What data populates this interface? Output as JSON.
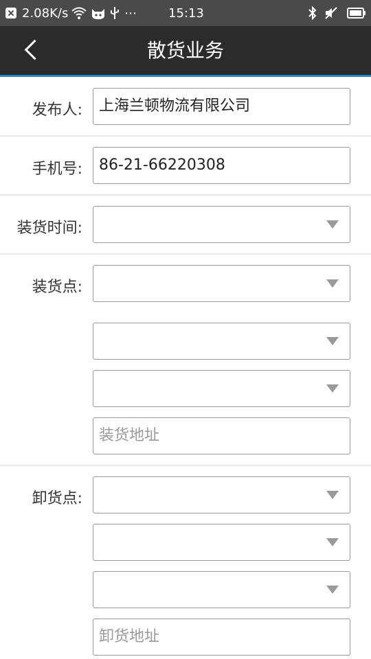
{
  "status_bar": {
    "net_speed": "2.08K/s",
    "misc_icons": "⋯",
    "time": "15:13"
  },
  "header": {
    "title": "散货业务"
  },
  "form": {
    "publisher_label": "发布人:",
    "publisher_value": "上海兰顿物流有限公司",
    "phone_label": "手机号:",
    "phone_value": "86-21-66220308",
    "load_time_label": "装货时间:",
    "load_point_label": "装货点:",
    "load_address_placeholder": "装货地址",
    "unload_point_label": "卸货点:",
    "unload_address_placeholder": "卸货地址"
  },
  "colors": {
    "status_bar_bg": "#4a4a4a",
    "header_bg": "#2b2b2b",
    "header_accent": "#1e88c8"
  },
  "icons": [
    "close-notification-icon",
    "wifi-icon",
    "cat-icon",
    "usb-icon",
    "bluetooth-icon",
    "mute-icon",
    "battery-icon",
    "back-icon",
    "dropdown-arrow-icon"
  ]
}
